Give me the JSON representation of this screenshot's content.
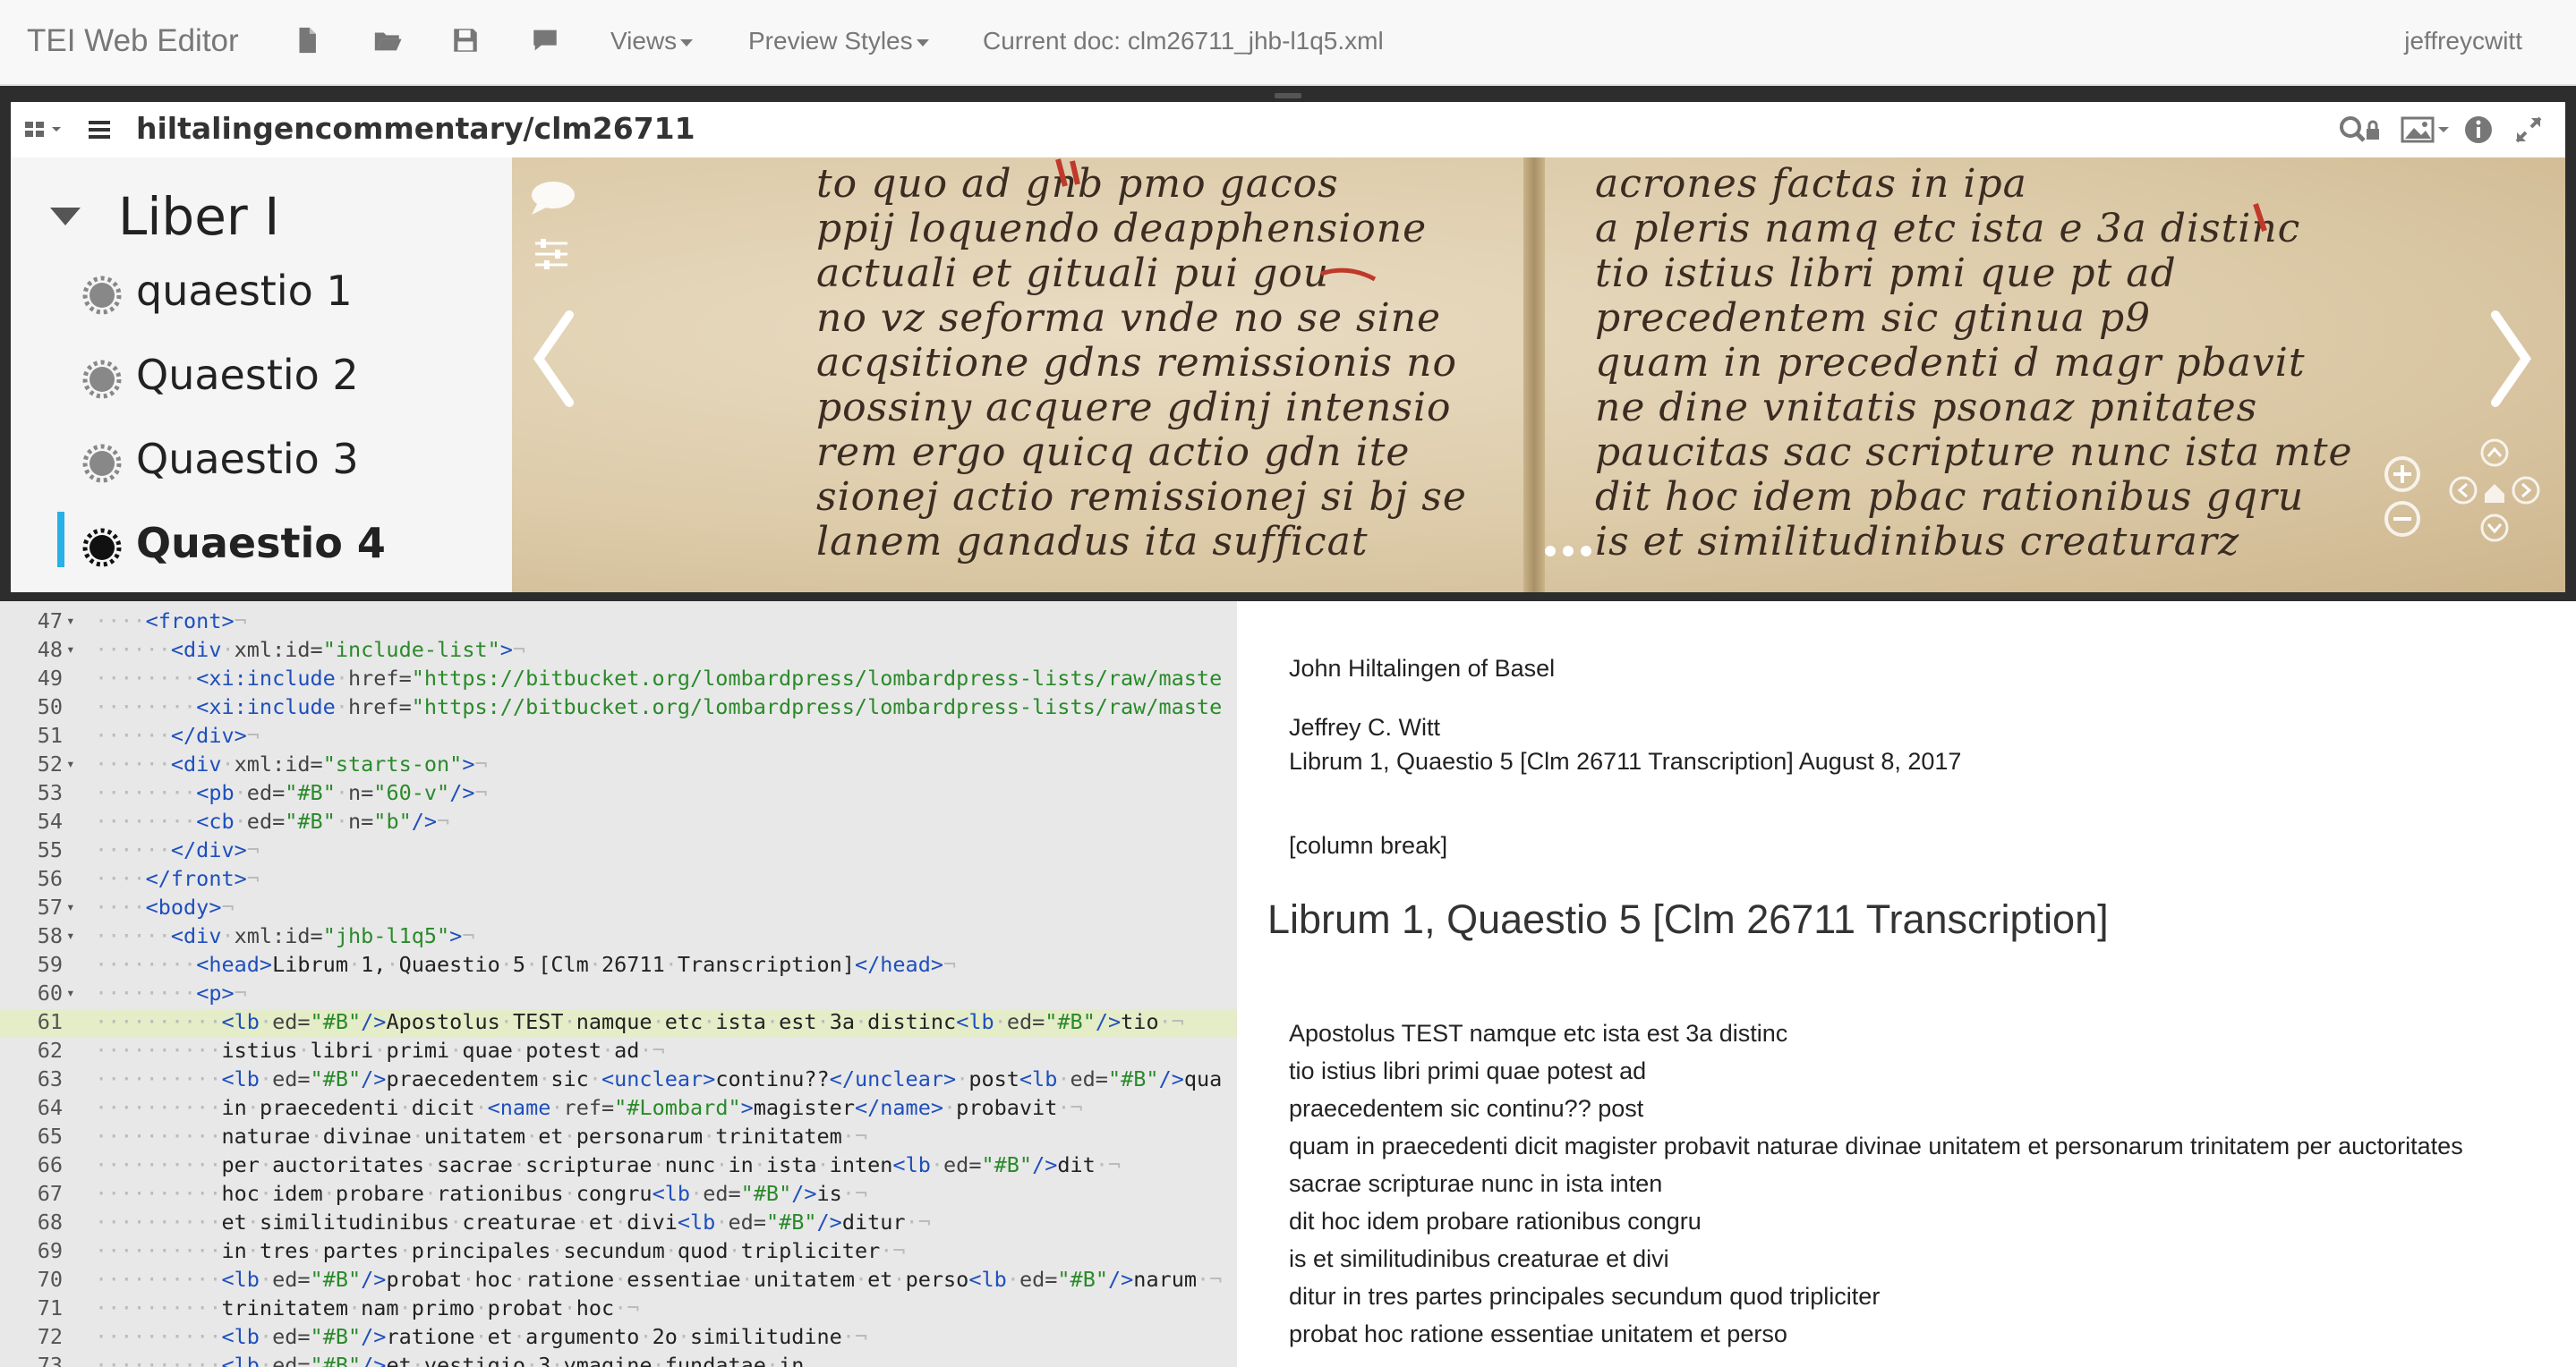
{
  "navbar": {
    "brand": "TEI Web Editor",
    "icons": [
      "file-icon",
      "folder-open-icon",
      "save-icon",
      "comment-icon"
    ],
    "views_label": "Views",
    "preview_styles_label": "Preview Styles",
    "current_doc": "Current doc: clm26711_jhb-l1q5.xml",
    "user": "jeffreycwitt"
  },
  "viewer": {
    "title": "hiltalingencommentary/clm26711",
    "toc": {
      "heading": "Liber I",
      "items": [
        "quaestio 1",
        "Quaestio 2",
        "Quaestio 3",
        "Quaestio 4"
      ]
    },
    "manuscript_lines_left": [
      "to quo ad gnb pmo gacos",
      "ppij loquendo deapphensione",
      "actuali et gituali pui gou",
      "no vz seforma vnde no se sine",
      "acqsitione gdns remissionis no",
      "possiny acquere gdinj intensio",
      "rem ergo quicq actio gdn ite",
      "sionej actio remissionej si bj se",
      "lanem ganadus ita sufficat"
    ],
    "manuscript_lines_right": [
      "acrones factas in ipa",
      "a    pleris namq etc ista e 3a distinc",
      "tio istius libri pmi que pt ad",
      "precedentem sic gtinua p9",
      "quam in precedenti d magr pbavit",
      "ne dine vnitatis psonaz pnitates",
      "paucitas sac scripture nunc ista mte",
      "dit hoc idem pbac rationibus gqru",
      "is et similitudinibus creaturarz"
    ]
  },
  "editor": {
    "lines": [
      {
        "n": "47",
        "fold": true,
        "html": "<span class='dot'>····</span><span class='tag'>&lt;front&gt;</span><span class='dot'>¬</span>"
      },
      {
        "n": "48",
        "fold": true,
        "html": "<span class='dot'>······</span><span class='tag'>&lt;div</span><span class='dot'>·</span><span class='attr'>xml:id=</span><span class='val'>\"include-list\"</span><span class='tag'>&gt;</span><span class='dot'>¬</span>"
      },
      {
        "n": "49",
        "fold": false,
        "html": "<span class='dot'>········</span><span class='tag'>&lt;xi:include</span><span class='dot'>·</span><span class='attr'>href=</span><span class='val'>\"https://bitbucket.org/lombardpress/lombardpress-lists/raw/maste</span>"
      },
      {
        "n": "50",
        "fold": false,
        "html": "<span class='dot'>········</span><span class='tag'>&lt;xi:include</span><span class='dot'>·</span><span class='attr'>href=</span><span class='val'>\"https://bitbucket.org/lombardpress/lombardpress-lists/raw/maste</span>"
      },
      {
        "n": "51",
        "fold": false,
        "html": "<span class='dot'>······</span><span class='tag'>&lt;/div&gt;</span><span class='dot'>¬</span>"
      },
      {
        "n": "52",
        "fold": true,
        "html": "<span class='dot'>······</span><span class='tag'>&lt;div</span><span class='dot'>·</span><span class='attr'>xml:id=</span><span class='val'>\"starts-on\"</span><span class='tag'>&gt;</span><span class='dot'>¬</span>"
      },
      {
        "n": "53",
        "fold": false,
        "html": "<span class='dot'>········</span><span class='tag'>&lt;pb</span><span class='dot'>·</span><span class='attr'>ed=</span><span class='val'>\"#B\"</span><span class='dot'>·</span><span class='attr'>n=</span><span class='val'>\"60-v\"</span><span class='tag'>/&gt;</span><span class='dot'>¬</span>"
      },
      {
        "n": "54",
        "fold": false,
        "html": "<span class='dot'>········</span><span class='tag'>&lt;cb</span><span class='dot'>·</span><span class='attr'>ed=</span><span class='val'>\"#B\"</span><span class='dot'>·</span><span class='attr'>n=</span><span class='val'>\"b\"</span><span class='tag'>/&gt;</span><span class='dot'>¬</span>"
      },
      {
        "n": "55",
        "fold": false,
        "html": "<span class='dot'>······</span><span class='tag'>&lt;/div&gt;</span><span class='dot'>¬</span>"
      },
      {
        "n": "56",
        "fold": false,
        "html": "<span class='dot'>····</span><span class='tag'>&lt;/front&gt;</span><span class='dot'>¬</span>"
      },
      {
        "n": "57",
        "fold": true,
        "html": "<span class='dot'>····</span><span class='tag'>&lt;body&gt;</span><span class='dot'>¬</span>"
      },
      {
        "n": "58",
        "fold": true,
        "html": "<span class='dot'>······</span><span class='tag'>&lt;div</span><span class='dot'>·</span><span class='attr'>xml:id=</span><span class='val'>\"jhb-l1q5\"</span><span class='tag'>&gt;</span><span class='dot'>¬</span>"
      },
      {
        "n": "59",
        "fold": false,
        "html": "<span class='dot'>········</span><span class='tag'>&lt;head&gt;</span><span class='txt'>Librum<span class='dot'>·</span>1,<span class='dot'>·</span>Quaestio<span class='dot'>·</span>5<span class='dot'>·</span>[Clm<span class='dot'>·</span>26711<span class='dot'>·</span>Transcription]</span><span class='tag'>&lt;/head&gt;</span><span class='dot'>¬</span>"
      },
      {
        "n": "60",
        "fold": true,
        "html": "<span class='dot'>········</span><span class='tag'>&lt;p&gt;</span><span class='dot'>¬</span>"
      },
      {
        "n": "61",
        "fold": false,
        "active": true,
        "html": "<span class='dot'>··········</span><span class='tag'>&lt;lb</span><span class='dot'>·</span><span class='attr'>ed=</span><span class='val'>\"#B\"</span><span class='tag'>/&gt;</span><span class='txt'>Apostolus<span class='dot'>·</span>TEST<span class='dot'>·</span>namque<span class='dot'>·</span>etc<span class='dot'>·</span>ista<span class='dot'>·</span>est<span class='dot'>·</span>3a<span class='dot'>·</span>distinc</span><span class='tag'>&lt;lb</span><span class='dot'>·</span><span class='attr'>ed=</span><span class='val'>\"#B\"</span><span class='tag'>/&gt;</span><span class='txt'>tio</span><span class='dot'>·¬</span>"
      },
      {
        "n": "62",
        "fold": false,
        "html": "<span class='dot'>··········</span><span class='txt'>istius<span class='dot'>·</span>libri<span class='dot'>·</span>primi<span class='dot'>·</span>quae<span class='dot'>·</span>potest<span class='dot'>·</span>ad</span><span class='dot'>·¬</span>"
      },
      {
        "n": "63",
        "fold": false,
        "html": "<span class='dot'>··········</span><span class='tag'>&lt;lb</span><span class='dot'>·</span><span class='attr'>ed=</span><span class='val'>\"#B\"</span><span class='tag'>/&gt;</span><span class='txt'>praecedentem<span class='dot'>·</span>sic<span class='dot'>·</span></span><span class='tag'>&lt;unclear&gt;</span><span class='txt'>continu??</span><span class='tag'>&lt;/unclear&gt;</span><span class='dot'>·</span><span class='txt'>post</span><span class='tag'>&lt;lb</span><span class='dot'>·</span><span class='attr'>ed=</span><span class='val'>\"#B\"</span><span class='tag'>/&gt;</span><span class='txt'>qua</span>"
      },
      {
        "n": "64",
        "fold": false,
        "html": "<span class='dot'>··········</span><span class='txt'>in<span class='dot'>·</span>praecedenti<span class='dot'>·</span>dicit<span class='dot'>·</span></span><span class='tag'>&lt;name</span><span class='dot'>·</span><span class='attr'>ref=</span><span class='val'>\"#Lombard\"</span><span class='tag'>&gt;</span><span class='txt'>magister</span><span class='tag'>&lt;/name&gt;</span><span class='dot'>·</span><span class='txt'>probavit</span><span class='dot'>·¬</span>"
      },
      {
        "n": "65",
        "fold": false,
        "html": "<span class='dot'>··········</span><span class='txt'>naturae<span class='dot'>·</span>divinae<span class='dot'>·</span>unitatem<span class='dot'>·</span>et<span class='dot'>·</span>personarum<span class='dot'>·</span>trinitatem</span><span class='dot'>·¬</span>"
      },
      {
        "n": "66",
        "fold": false,
        "html": "<span class='dot'>··········</span><span class='txt'>per<span class='dot'>·</span>auctoritates<span class='dot'>·</span>sacrae<span class='dot'>·</span>scripturae<span class='dot'>·</span>nunc<span class='dot'>·</span>in<span class='dot'>·</span>ista<span class='dot'>·</span>inten</span><span class='tag'>&lt;lb</span><span class='dot'>·</span><span class='attr'>ed=</span><span class='val'>\"#B\"</span><span class='tag'>/&gt;</span><span class='txt'>dit</span><span class='dot'>·¬</span>"
      },
      {
        "n": "67",
        "fold": false,
        "html": "<span class='dot'>··········</span><span class='txt'>hoc<span class='dot'>·</span>idem<span class='dot'>·</span>probare<span class='dot'>·</span>rationibus<span class='dot'>·</span>congru</span><span class='tag'>&lt;lb</span><span class='dot'>·</span><span class='attr'>ed=</span><span class='val'>\"#B\"</span><span class='tag'>/&gt;</span><span class='txt'>is</span><span class='dot'>·¬</span>"
      },
      {
        "n": "68",
        "fold": false,
        "html": "<span class='dot'>··········</span><span class='txt'>et<span class='dot'>·</span>similitudinibus<span class='dot'>·</span>creaturae<span class='dot'>·</span>et<span class='dot'>·</span>divi</span><span class='tag'>&lt;lb</span><span class='dot'>·</span><span class='attr'>ed=</span><span class='val'>\"#B\"</span><span class='tag'>/&gt;</span><span class='txt'>ditur</span><span class='dot'>·¬</span>"
      },
      {
        "n": "69",
        "fold": false,
        "html": "<span class='dot'>··········</span><span class='txt'>in<span class='dot'>·</span>tres<span class='dot'>·</span>partes<span class='dot'>·</span>principales<span class='dot'>·</span>secundum<span class='dot'>·</span>quod<span class='dot'>·</span>tripliciter</span><span class='dot'>·¬</span>"
      },
      {
        "n": "70",
        "fold": false,
        "html": "<span class='dot'>··········</span><span class='tag'>&lt;lb</span><span class='dot'>·</span><span class='attr'>ed=</span><span class='val'>\"#B\"</span><span class='tag'>/&gt;</span><span class='txt'>probat<span class='dot'>·</span>hoc<span class='dot'>·</span>ratione<span class='dot'>·</span>essentiae<span class='dot'>·</span>unitatem<span class='dot'>·</span>et<span class='dot'>·</span>perso</span><span class='tag'>&lt;lb</span><span class='dot'>·</span><span class='attr'>ed=</span><span class='val'>\"#B\"</span><span class='tag'>/&gt;</span><span class='txt'>narum</span><span class='dot'>·¬</span>"
      },
      {
        "n": "71",
        "fold": false,
        "html": "<span class='dot'>··········</span><span class='txt'>trinitatem<span class='dot'>·</span>nam<span class='dot'>·</span>primo<span class='dot'>·</span>probat<span class='dot'>·</span>hoc</span><span class='dot'>·¬</span>"
      },
      {
        "n": "72",
        "fold": false,
        "html": "<span class='dot'>··········</span><span class='tag'>&lt;lb</span><span class='dot'>·</span><span class='attr'>ed=</span><span class='val'>\"#B\"</span><span class='tag'>/&gt;</span><span class='txt'>ratione<span class='dot'>·</span>et<span class='dot'>·</span>argumento<span class='dot'>·</span>2o<span class='dot'>·</span>similitudine</span><span class='dot'>·¬</span>"
      },
      {
        "n": "73",
        "fold": false,
        "html": "<span class='dot'>··········</span><span class='tag'>&lt;lb</span><span class='dot'>·</span><span class='attr'>ed=</span><span class='val'>\"#B\"</span><span class='tag'>/&gt;</span><span class='txt'>et<span class='dot'>·</span>vestigio<span class='dot'>·</span>3<span class='dot'>·</span>ymagine<span class='dot'>·</span>fundatae<span class='dot'>·</span>in</span>"
      }
    ]
  },
  "preview": {
    "author": "John Hiltalingen of Basel",
    "editor": "Jeffrey C. Witt",
    "doc_line": "Librum 1, Quaestio 5 [Clm 26711 Transcription] August 8, 2017",
    "column_break": "[column break]",
    "heading": "Librum 1, Quaestio 5 [Clm 26711 Transcription]",
    "paragraph_lines": [
      "Apostolus TEST namque etc ista est 3a distinc",
      "tio istius libri primi quae potest ad",
      "praecedentem sic continu?? post",
      "quam in praecedenti dicit magister probavit naturae divinae unitatem et personarum trinitatem per auctoritates",
      "sacrae scripturae nunc in ista inten",
      "dit hoc idem probare rationibus congru",
      "is et similitudinibus creaturae et divi",
      "ditur in tres partes principales secundum quod tripliciter",
      "probat hoc ratione essentiae unitatem et perso"
    ]
  },
  "colors": {
    "accent": "#29b0e8",
    "frame": "#2d2d2d",
    "active_line": "#e4ecc8",
    "tag": "#1e4fbd",
    "attr_value": "#2a8a2a"
  }
}
